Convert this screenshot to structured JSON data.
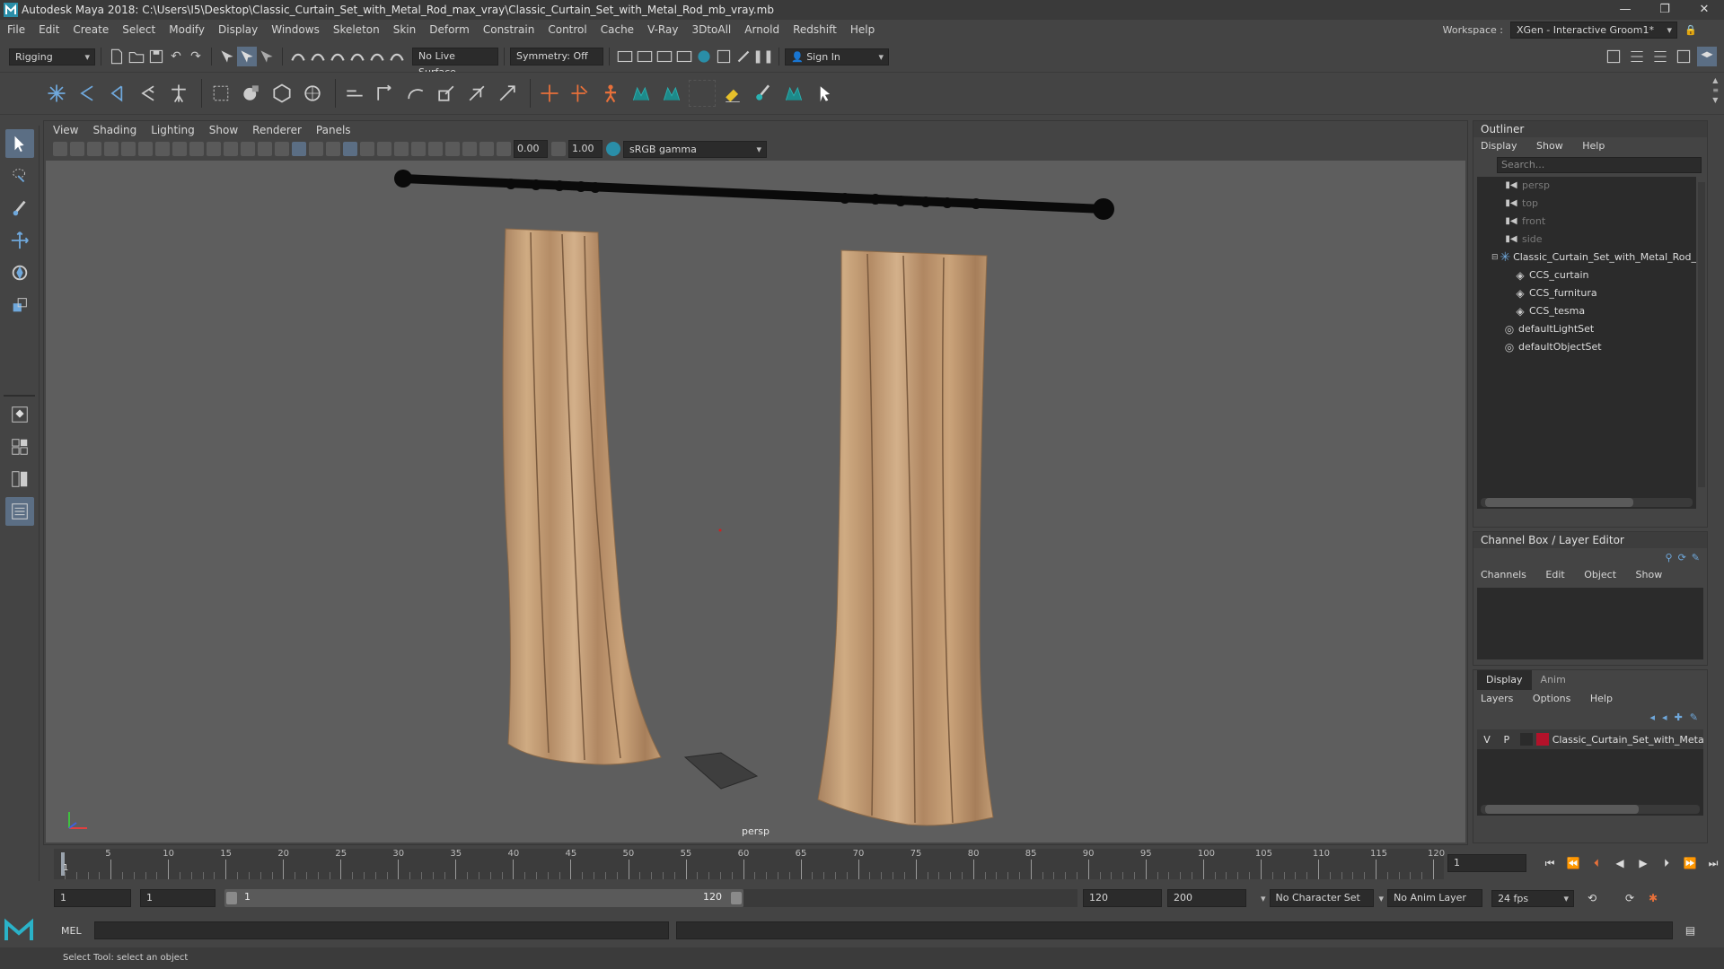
{
  "window": {
    "title": "Autodesk Maya 2018: C:\\Users\\I5\\Desktop\\Classic_Curtain_Set_with_Metal_Rod_max_vray\\Classic_Curtain_Set_with_Metal_Rod_mb_vray.mb"
  },
  "menubar": {
    "items": [
      "File",
      "Edit",
      "Create",
      "Select",
      "Modify",
      "Display",
      "Windows",
      "Skeleton",
      "Skin",
      "Deform",
      "Constrain",
      "Control",
      "Cache",
      "V-Ray",
      "3DtoAll",
      "Arnold",
      "Redshift",
      "Help"
    ],
    "workspace_label": "Workspace :",
    "workspace_value": "XGen - Interactive Groom1*"
  },
  "statusline": {
    "mode": "Rigging",
    "live_surface": "No Live Surface",
    "symmetry": "Symmetry: Off",
    "sign_in": "Sign In"
  },
  "viewport": {
    "menu": [
      "View",
      "Shading",
      "Lighting",
      "Show",
      "Renderer",
      "Panels"
    ],
    "exposure": "0.00",
    "gamma": "1.00",
    "color_space": "sRGB gamma",
    "camera_label": "persp"
  },
  "outliner": {
    "title": "Outliner",
    "menu": [
      "Display",
      "Show",
      "Help"
    ],
    "search_placeholder": "Search...",
    "items": [
      {
        "label": "persp",
        "dim": true,
        "indent": 0,
        "icon": "camera-icon"
      },
      {
        "label": "top",
        "dim": true,
        "indent": 0,
        "icon": "camera-icon"
      },
      {
        "label": "front",
        "dim": true,
        "indent": 0,
        "icon": "camera-icon"
      },
      {
        "label": "side",
        "dim": true,
        "indent": 0,
        "icon": "camera-icon"
      },
      {
        "label": "Classic_Curtain_Set_with_Metal_Rod_",
        "dim": false,
        "indent": 0,
        "icon": "group-icon"
      },
      {
        "label": "CCS_curtain",
        "dim": false,
        "indent": 1,
        "icon": "mesh-icon"
      },
      {
        "label": "CCS_furnitura",
        "dim": false,
        "indent": 1,
        "icon": "mesh-icon"
      },
      {
        "label": "CCS_tesma",
        "dim": false,
        "indent": 1,
        "icon": "mesh-icon"
      },
      {
        "label": "defaultLightSet",
        "dim": false,
        "indent": 0,
        "icon": "set-icon"
      },
      {
        "label": "defaultObjectSet",
        "dim": false,
        "indent": 0,
        "icon": "set-icon"
      }
    ]
  },
  "channelbox": {
    "title": "Channel Box / Layer Editor",
    "menu": [
      "Channels",
      "Edit",
      "Object",
      "Show"
    ]
  },
  "layereditor": {
    "tabs": [
      "Display",
      "Anim"
    ],
    "menu": [
      "Layers",
      "Options",
      "Help"
    ],
    "layer": {
      "v": "V",
      "p": "P",
      "name": "Classic_Curtain_Set_with_Meta",
      "color": "#b3122a"
    }
  },
  "timeline": {
    "ticks": [
      "5",
      "10",
      "15",
      "20",
      "25",
      "30",
      "35",
      "40",
      "45",
      "50",
      "55",
      "60",
      "65",
      "70",
      "75",
      "80",
      "85",
      "90",
      "95",
      "100",
      "105",
      "110",
      "115",
      "120"
    ],
    "current_frame_label": "1",
    "current_frame": "1"
  },
  "range": {
    "start": "1",
    "playback_start": "1",
    "slider_start": "1",
    "slider_end": "120",
    "playback_end": "120",
    "end": "200",
    "character_set": "No Character Set",
    "anim_layer": "No Anim Layer",
    "fps": "24 fps"
  },
  "cmdline": {
    "label": "MEL"
  },
  "helpline": {
    "text": "Select Tool: select an object"
  },
  "colors": {
    "curtain": "#c09a72",
    "rod": "#0a0a0a",
    "viewport_bg": "#5e5e5e"
  }
}
